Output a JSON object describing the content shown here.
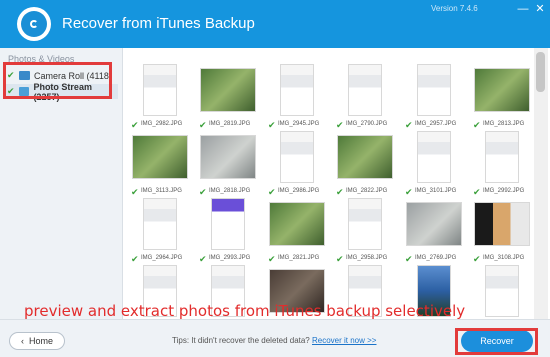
{
  "app": {
    "title": "Recover from iTunes Backup",
    "version": "Version 7.4.6"
  },
  "window_controls": {
    "minimize": "—",
    "close": "✕"
  },
  "sidebar": {
    "header": "Photos & Videos",
    "items": [
      {
        "label": "Camera Roll (4118)",
        "checked": true,
        "selected": false
      },
      {
        "label": "Photo Stream (2257)",
        "checked": true,
        "selected": true
      }
    ]
  },
  "photos": [
    {
      "name": "IMG_2982.JPG",
      "kind": "screenshot"
    },
    {
      "name": "IMG_2819.JPG",
      "kind": "photo-green"
    },
    {
      "name": "IMG_2945.JPG",
      "kind": "screenshot"
    },
    {
      "name": "IMG_2790.JPG",
      "kind": "screenshot"
    },
    {
      "name": "IMG_2957.JPG",
      "kind": "screenshot"
    },
    {
      "name": "IMG_2813.JPG",
      "kind": "photo-green"
    },
    {
      "name": "IMG_3113.JPG",
      "kind": "photo-green"
    },
    {
      "name": "IMG_2818.JPG",
      "kind": "photo-gray"
    },
    {
      "name": "IMG_2986.JPG",
      "kind": "screenshot"
    },
    {
      "name": "IMG_2822.JPG",
      "kind": "photo-green"
    },
    {
      "name": "IMG_3101.JPG",
      "kind": "screenshot"
    },
    {
      "name": "IMG_2992.JPG",
      "kind": "screenshot"
    },
    {
      "name": "IMG_2964.JPG",
      "kind": "screenshot"
    },
    {
      "name": "IMG_2993.JPG",
      "kind": "purple"
    },
    {
      "name": "IMG_2821.JPG",
      "kind": "photo-green"
    },
    {
      "name": "IMG_2958.JPG",
      "kind": "screenshot"
    },
    {
      "name": "IMG_2769.JPG",
      "kind": "photo-gray"
    },
    {
      "name": "IMG_3108.JPG",
      "kind": "phones"
    },
    {
      "name": "IMG_2983.JPG",
      "kind": "screenshot"
    },
    {
      "name": "IMG_2982.JPG",
      "kind": "screenshot"
    },
    {
      "name": "IMG_3107.JPG",
      "kind": "photo-dark"
    },
    {
      "name": "IMG_2957.JPG",
      "kind": "screenshot"
    },
    {
      "name": "IMG_2999.JPG",
      "kind": "photo-blue"
    },
    {
      "name": "IMG_2961.JPG",
      "kind": "screenshot"
    }
  ],
  "caption": "preview and extract photos from iTunes backup selectively",
  "footer": {
    "home_label": "Home",
    "tips_text": "Tips: It didn't recover the deleted data?",
    "tips_link": "Recover it now >>",
    "recover_label": "Recover"
  },
  "colors": {
    "title_bar": "#1595de",
    "accent": "#1c8fdc",
    "highlight_box": "#e23b3b",
    "check": "#3aa03a"
  }
}
